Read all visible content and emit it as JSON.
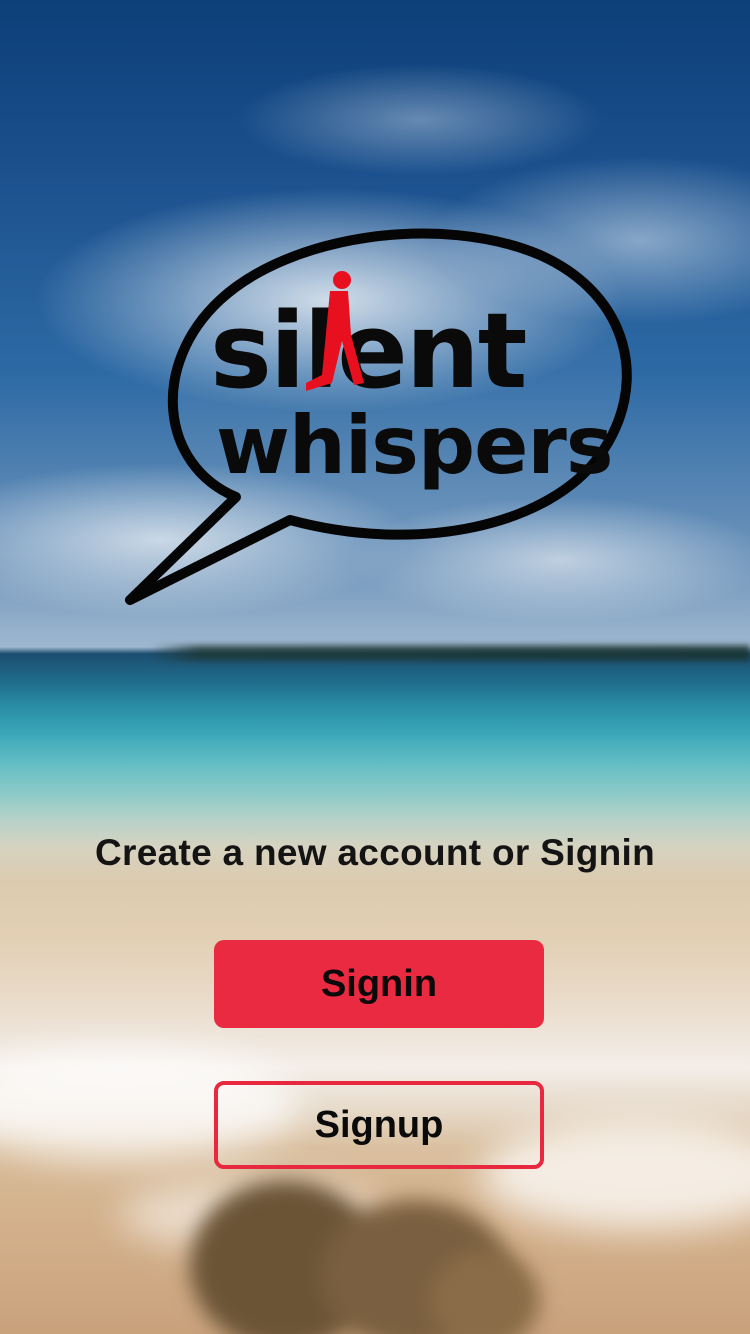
{
  "app": {
    "logo": {
      "line1": "silent",
      "line2": "whispers"
    }
  },
  "welcome": {
    "tagline": "Create a new account or Signin",
    "signin_label": "Signin",
    "signup_label": "Signup"
  },
  "colors": {
    "accent": "#ea2a40",
    "logo_figure": "#e8101e",
    "text": "#141414"
  },
  "icons": {
    "logo_bubble": "speech-bubble-icon",
    "logo_figure": "walking-man-icon"
  }
}
